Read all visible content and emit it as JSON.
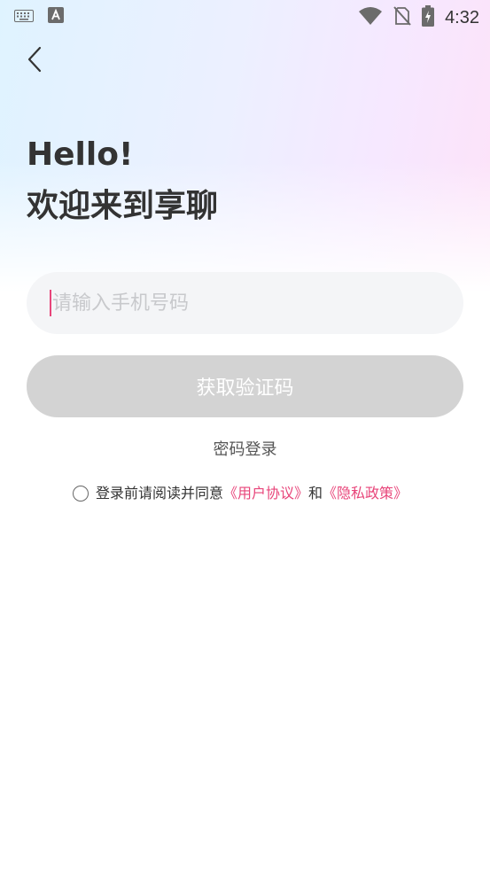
{
  "status_bar": {
    "time": "4:32",
    "icons": [
      "keyboard-icon",
      "app-a-icon",
      "wifi-icon",
      "no-sim-icon",
      "battery-charging-icon"
    ]
  },
  "nav": {
    "back_icon": "chevron-left-icon"
  },
  "heading": {
    "line1": "Hello!",
    "line2": "欢迎来到享聊"
  },
  "phone_input": {
    "placeholder": "请输入手机号码",
    "value": ""
  },
  "code_button": {
    "label": "获取验证码"
  },
  "password_login": {
    "label": "密码登录"
  },
  "agreement": {
    "prefix": "登录前请阅读并同意",
    "user_agreement": "《用户协议》",
    "and": "和",
    "privacy_policy": "《隐私政策》"
  },
  "colors": {
    "accent": "#e8457a",
    "button_disabled": "#d3d3d3",
    "input_bg": "#f4f5f7",
    "text_primary": "#333333"
  }
}
